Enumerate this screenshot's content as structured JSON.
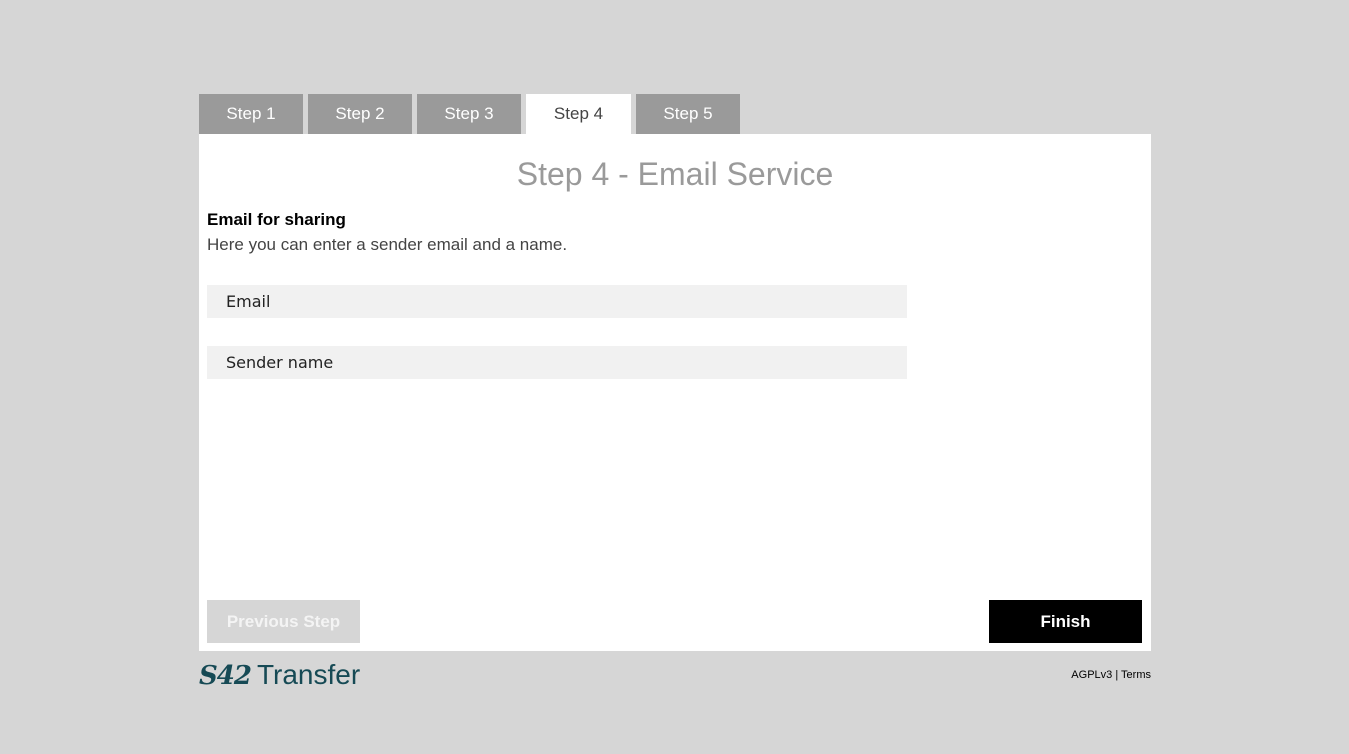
{
  "tabs": [
    {
      "label": "Step 1",
      "active": false
    },
    {
      "label": "Step 2",
      "active": false
    },
    {
      "label": "Step 3",
      "active": false
    },
    {
      "label": "Step 4",
      "active": true
    },
    {
      "label": "Step 5",
      "active": false
    }
  ],
  "page": {
    "title": "Step 4 - Email Service",
    "section_title": "Email for sharing",
    "section_description": "Here you can enter a sender email and a name."
  },
  "form": {
    "email": {
      "value": "",
      "placeholder": "Email"
    },
    "sender_name": {
      "value": "",
      "placeholder": "Sender name"
    }
  },
  "buttons": {
    "previous": "Previous Step",
    "finish": "Finish"
  },
  "footer": {
    "logo_mark": "S42",
    "logo_word": "Transfer",
    "license": "AGPLv3",
    "separator": "|",
    "terms": "Terms"
  },
  "colors": {
    "background": "#d6d6d6",
    "tab_inactive": "#9a9a9a",
    "tab_active": "#ffffff",
    "title_gray": "#9a9a9a",
    "field_bg": "#f1f1f1",
    "finish_bg": "#000000",
    "prev_bg": "#d6d6d6",
    "brand": "#164a55"
  }
}
